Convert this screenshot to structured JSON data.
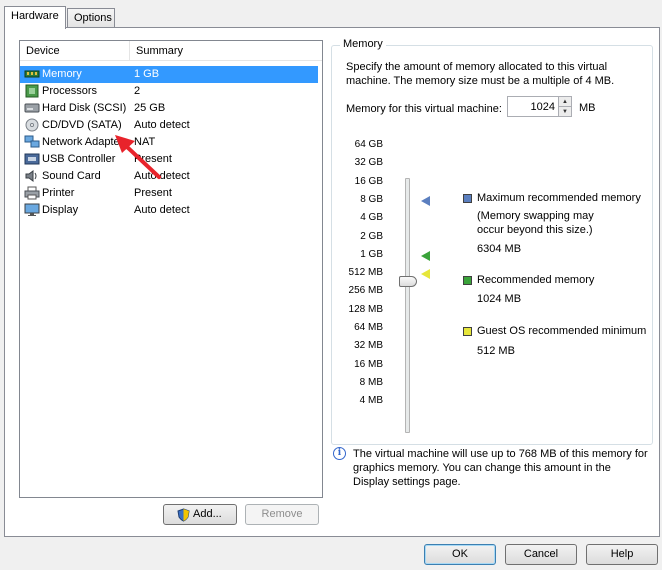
{
  "tabs": [
    {
      "label": "Hardware",
      "active": true
    },
    {
      "label": "Options",
      "active": false
    }
  ],
  "device_list": {
    "headers": {
      "device": "Device",
      "summary": "Summary"
    },
    "rows": [
      {
        "name": "Memory",
        "summary": "1 GB",
        "icon": "memory-icon",
        "selected": true
      },
      {
        "name": "Processors",
        "summary": "2",
        "icon": "processor-icon",
        "selected": false
      },
      {
        "name": "Hard Disk (SCSI)",
        "summary": "25 GB",
        "icon": "hard-disk-icon",
        "selected": false
      },
      {
        "name": "CD/DVD (SATA)",
        "summary": "Auto detect",
        "icon": "cd-dvd-icon",
        "selected": false
      },
      {
        "name": "Network Adapter",
        "summary": "NAT",
        "icon": "network-adapter-icon",
        "selected": false
      },
      {
        "name": "USB Controller",
        "summary": "Present",
        "icon": "usb-icon",
        "selected": false
      },
      {
        "name": "Sound Card",
        "summary": "Auto detect",
        "icon": "sound-card-icon",
        "selected": false
      },
      {
        "name": "Printer",
        "summary": "Present",
        "icon": "printer-icon",
        "selected": false
      },
      {
        "name": "Display",
        "summary": "Auto detect",
        "icon": "display-icon",
        "selected": false
      }
    ]
  },
  "buttons": {
    "add": "Add...",
    "remove": "Remove",
    "ok": "OK",
    "cancel": "Cancel",
    "help": "Help"
  },
  "memory": {
    "legend": "Memory",
    "description": "Specify the amount of memory allocated to this virtual machine. The memory size must be a multiple of 4 MB.",
    "field_label": "Memory for this virtual machine:",
    "value": "1024",
    "unit": "MB",
    "scale": [
      "64 GB",
      "32 GB",
      "16 GB",
      "8 GB",
      "4 GB",
      "2 GB",
      "1 GB",
      "512 MB",
      "256 MB",
      "128 MB",
      "64 MB",
      "32 MB",
      "16 MB",
      "8 MB",
      "4 MB"
    ],
    "legend_items": {
      "max_label": "Maximum recommended memory",
      "max_note": "(Memory swapping may occur beyond this size.)",
      "max_value": "6304 MB",
      "rec_label": "Recommended memory",
      "rec_value": "1024 MB",
      "min_label": "Guest OS recommended minimum",
      "min_value": "512 MB"
    },
    "colors": {
      "max": "#5b7fbf",
      "recommended": "#3aa33a",
      "minimum": "#e6e63a",
      "selection": "#3399ff",
      "arrow": "#e8232b"
    }
  },
  "info_text": "The virtual machine will use up to 768 MB of this memory for graphics memory. You can change this amount in the Display settings page."
}
